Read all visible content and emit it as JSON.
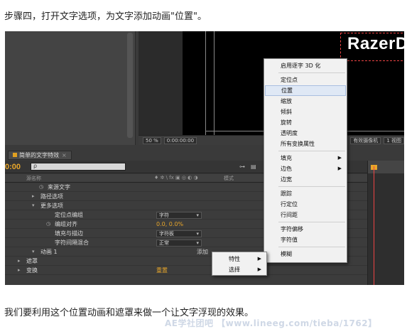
{
  "step_title": "步骤四，打开文字选项，为文字添加动画\"位置\"。",
  "caption": "我们要利用这个位置动画和遮罩来做一个让文字浮现的效果。",
  "watermark": "AE学社团吧 【www.lineeg.com/tieba/1762】",
  "viewer": {
    "text": "RazerDP",
    "zoom": "50 %",
    "timecode": "0:00:00:00",
    "camera": "有效摄像机",
    "views": "1 视图"
  },
  "timeline": {
    "tab": "简单的文字特效",
    "timecode": "0:00",
    "search_placeholder": "ρ",
    "columns": {
      "source": "源名称",
      "mode": "模式",
      "switches": "♦ ✲ \\ fx ▣ ◎ ◐ ◑"
    },
    "rows": [
      {
        "label": "来源文字",
        "indent": 60,
        "kind": "stopwatch"
      },
      {
        "label": "路径选项",
        "indent": 50,
        "kind": "collapsed"
      },
      {
        "label": "更多选项",
        "indent": 50,
        "kind": "expanded"
      },
      {
        "label": "定位点编组",
        "indent": 70,
        "kind": "plain",
        "dropdown": "字符"
      },
      {
        "label": "编组对齐",
        "indent": 70,
        "kind": "stopwatch",
        "value": "0.0, 0.0%"
      },
      {
        "label": "填充与描边",
        "indent": 70,
        "kind": "plain",
        "dropdown": "字符板"
      },
      {
        "label": "字符间隔混合",
        "indent": 70,
        "kind": "plain",
        "dropdown": "正常"
      },
      {
        "label": "动画 1",
        "indent": 50,
        "kind": "expanded",
        "add": "添加"
      },
      {
        "label": "遮罩",
        "indent": 30,
        "kind": "collapsed"
      },
      {
        "label": "变换",
        "indent": 30,
        "kind": "collapsed",
        "value": "重置"
      }
    ]
  },
  "context_menu": {
    "items": [
      {
        "label": "启用逐字 3D 化"
      },
      {
        "sep": true
      },
      {
        "label": "定位点"
      },
      {
        "label": "位置",
        "highlighted": true
      },
      {
        "label": "缩放"
      },
      {
        "label": "倾斜"
      },
      {
        "label": "旋转"
      },
      {
        "label": "透明度"
      },
      {
        "label": "所有变换属性"
      },
      {
        "sep": true
      },
      {
        "label": "填充",
        "submenu": true
      },
      {
        "label": "边色",
        "submenu": true
      },
      {
        "label": "边宽"
      },
      {
        "sep": true
      },
      {
        "label": "跟踪"
      },
      {
        "label": "行定位"
      },
      {
        "label": "行间距"
      },
      {
        "sep": true
      },
      {
        "label": "字符偏移"
      },
      {
        "label": "字符值"
      },
      {
        "sep": true
      },
      {
        "label": "模糊"
      }
    ]
  },
  "add_menu": {
    "items": [
      {
        "label": "特性",
        "submenu": true
      },
      {
        "label": "选择",
        "submenu": true
      }
    ]
  },
  "colors": {
    "accent_orange": "#e8a62a",
    "highlight": "#dfe8f5",
    "panel_bg": "#3c3c3c"
  }
}
